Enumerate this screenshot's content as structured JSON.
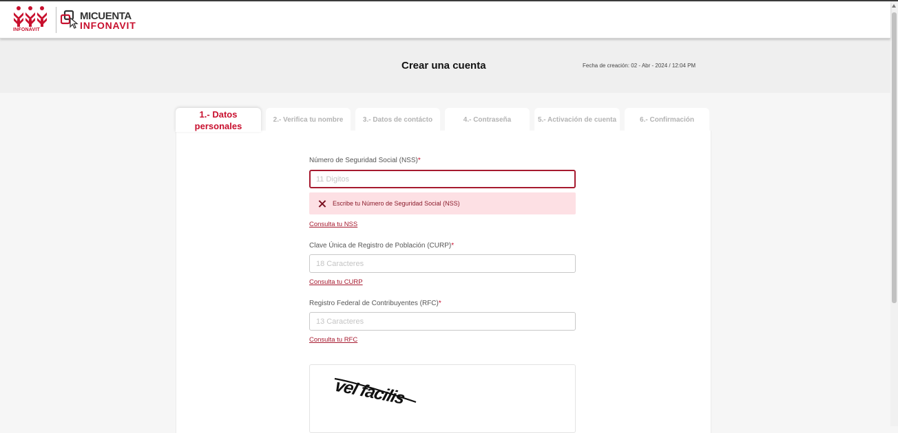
{
  "header": {
    "brand_logo": "INFONAVIT",
    "app_logo_line1": "MICUENTA",
    "app_logo_line2": "INFONAVIT"
  },
  "page": {
    "title": "Crear una cuenta",
    "creation_date": "Fecha de creación: 02 - Abr - 2024 / 12:04 PM"
  },
  "tabs": [
    {
      "label": "1.- Datos personales",
      "active": true
    },
    {
      "label": "2.- Verifica tu nombre",
      "active": false
    },
    {
      "label": "3.- Datos de contácto",
      "active": false
    },
    {
      "label": "4.- Contraseña",
      "active": false
    },
    {
      "label": "5.- Activación de cuenta",
      "active": false
    },
    {
      "label": "6.- Confirmación",
      "active": false
    }
  ],
  "form": {
    "nss": {
      "label": "Número de Seguridad Social (NSS)",
      "required_mark": "*",
      "placeholder": "11 Digitos",
      "value": "",
      "error": "Escribe tu Número de Seguridad Social (NSS)",
      "help_link": "Consulta tu NSS"
    },
    "curp": {
      "label": "Clave Única de Registro de Población (CURP)",
      "required_mark": "*",
      "placeholder": "18 Caracteres",
      "value": "",
      "help_link": "Consulta tu CURP"
    },
    "rfc": {
      "label": "Registro Federal de Contribuyentes (RFC)",
      "required_mark": "*",
      "placeholder": "13 Caracteres",
      "value": "",
      "help_link": "Consulta tu RFC"
    },
    "captcha": {
      "image_text": "vel facilis"
    }
  },
  "colors": {
    "brand_red": "#c8102e",
    "error_bg": "#fde0e4",
    "error_border": "#a6192e"
  },
  "icons": {
    "error": "close-x-icon",
    "brand": "infonavit-logo",
    "app": "micuenta-logo"
  }
}
